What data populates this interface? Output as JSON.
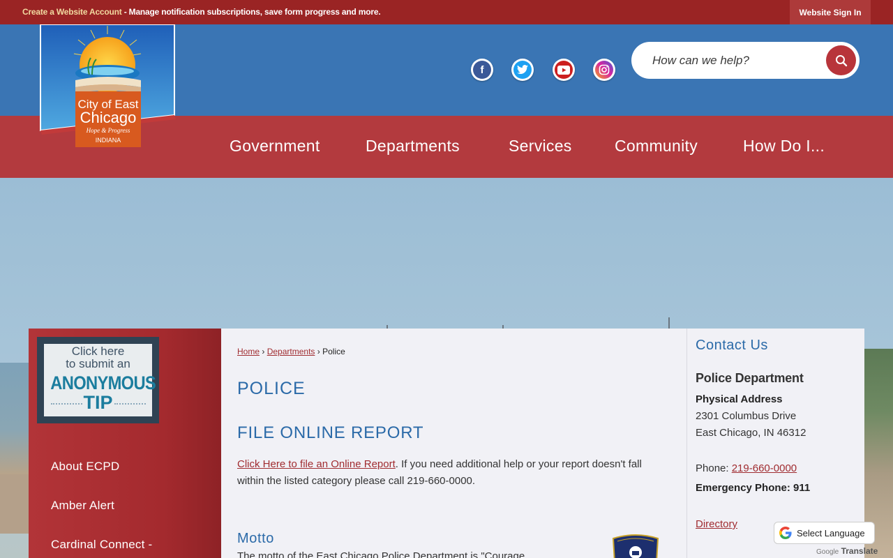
{
  "topbar": {
    "create_account_link": "Create a Website Account",
    "create_account_rest": " - Manage notification subscriptions, save form progress and more.",
    "sign_in_label": "Website Sign In"
  },
  "logo": {
    "line1": "City of East",
    "line2": "Chicago",
    "tagline": "Hope & Progress",
    "state": "INDIANA"
  },
  "social": [
    {
      "name": "facebook-icon",
      "glyph": "f",
      "color": "#3b5998"
    },
    {
      "name": "twitter-icon",
      "glyph": "t",
      "color": "#1da1f2"
    },
    {
      "name": "youtube-icon",
      "glyph": "▶",
      "color": "#cc1f1f"
    },
    {
      "name": "instagram-icon",
      "glyph": "◎",
      "color": "#c13584"
    }
  ],
  "search": {
    "placeholder": "How can we help?"
  },
  "nav": {
    "items": [
      "Government",
      "Departments",
      "Services",
      "Community",
      "How Do I..."
    ]
  },
  "sidebar": {
    "tip": {
      "line1": "Click here",
      "line2": "to submit an",
      "line3": "ANONYMOUS",
      "line4": "TIP"
    },
    "links": [
      "About ECPD",
      "Amber Alert",
      "Cardinal Connect -"
    ]
  },
  "breadcrumb": {
    "home": "Home",
    "sep1": "›",
    "departments": "Departments",
    "sep2": "›",
    "current": "Police"
  },
  "main": {
    "page_title": "POLICE",
    "section_title": "FILE ONLINE REPORT",
    "report_link": "Click Here to file an Online Report",
    "report_text": ". If you need additional help or your report doesn't fall within the listed category please call 219-660-0000.",
    "motto_title": "Motto",
    "motto_text": "The motto of the East Chicago Police Department is \"Courage"
  },
  "contact": {
    "title": "Contact Us",
    "dept_name": "Police Department",
    "address_label": "Physical Address",
    "address_line1": "2301 Columbus Drive",
    "address_line2": "East Chicago, IN 46312",
    "phone_label": "Phone: ",
    "phone_number": "219-660-0000",
    "emergency": "Emergency Phone: 911",
    "directory": "Directory"
  },
  "translate": {
    "label": "Select Language",
    "powered_by": "Google",
    "translate_word": "Translate"
  },
  "colors": {
    "topbar": "#9a2424",
    "header_blue": "#3a75b4",
    "nav_red": "#b33a3e",
    "heading_blue": "#2b6aa8",
    "link_red": "#a02c30"
  }
}
